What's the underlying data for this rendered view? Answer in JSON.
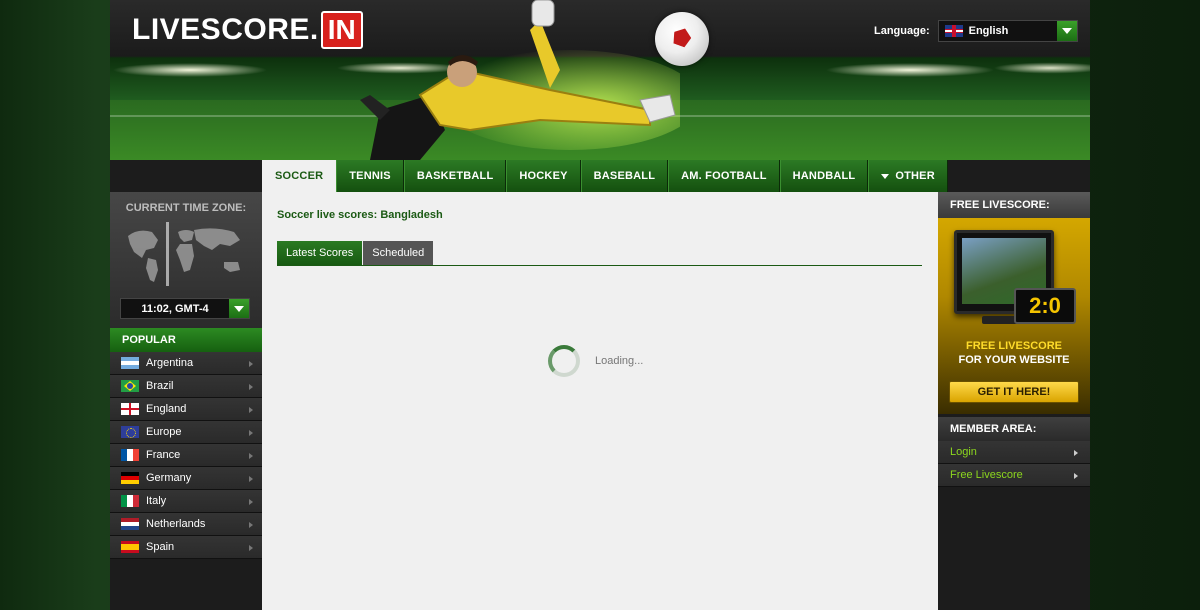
{
  "header": {
    "logo_text": "LIVESCORE.",
    "logo_badge": "IN",
    "language_label": "Language:",
    "language_value": "English",
    "language_flag": "uk-flag-icon"
  },
  "nav": {
    "tabs": [
      {
        "label": "SOCCER",
        "active": true
      },
      {
        "label": "TENNIS"
      },
      {
        "label": "BASKETBALL"
      },
      {
        "label": "HOCKEY"
      },
      {
        "label": "BASEBALL"
      },
      {
        "label": "AM. FOOTBALL"
      },
      {
        "label": "HANDBALL"
      },
      {
        "label": "OTHER"
      }
    ]
  },
  "left": {
    "timezone_title": "CURRENT TIME ZONE:",
    "timezone_value": "11:02, GMT-4",
    "popular_title": "POPULAR",
    "popular": [
      {
        "label": "Argentina",
        "flag": "argentina-flag-icon"
      },
      {
        "label": "Brazil",
        "flag": "brazil-flag-icon"
      },
      {
        "label": "England",
        "flag": "england-flag-icon"
      },
      {
        "label": "Europe",
        "flag": "europe-flag-icon"
      },
      {
        "label": "France",
        "flag": "france-flag-icon"
      },
      {
        "label": "Germany",
        "flag": "germany-flag-icon"
      },
      {
        "label": "Italy",
        "flag": "italy-flag-icon"
      },
      {
        "label": "Netherlands",
        "flag": "netherlands-flag-icon"
      },
      {
        "label": "Spain",
        "flag": "spain-flag-icon"
      }
    ]
  },
  "main": {
    "title": "Soccer live scores: Bangladesh",
    "subtabs": [
      {
        "label": "Latest Scores",
        "active": true
      },
      {
        "label": "Scheduled"
      }
    ],
    "loading_text": "Loading..."
  },
  "right": {
    "free_title": "FREE LIVESCORE:",
    "score_display": "2:0",
    "promo_line1": "FREE LIVESCORE",
    "promo_line2": "FOR YOUR WEBSITE",
    "cta_label": "GET IT HERE!",
    "member_title": "MEMBER AREA:",
    "member_links": [
      {
        "label": "Login"
      },
      {
        "label": "Free Livescore"
      }
    ]
  },
  "colors": {
    "brand_green": "#1b5a14",
    "accent_red": "#d8211d",
    "link_green": "#8cd61e",
    "promo_gold": "#d4a700"
  }
}
